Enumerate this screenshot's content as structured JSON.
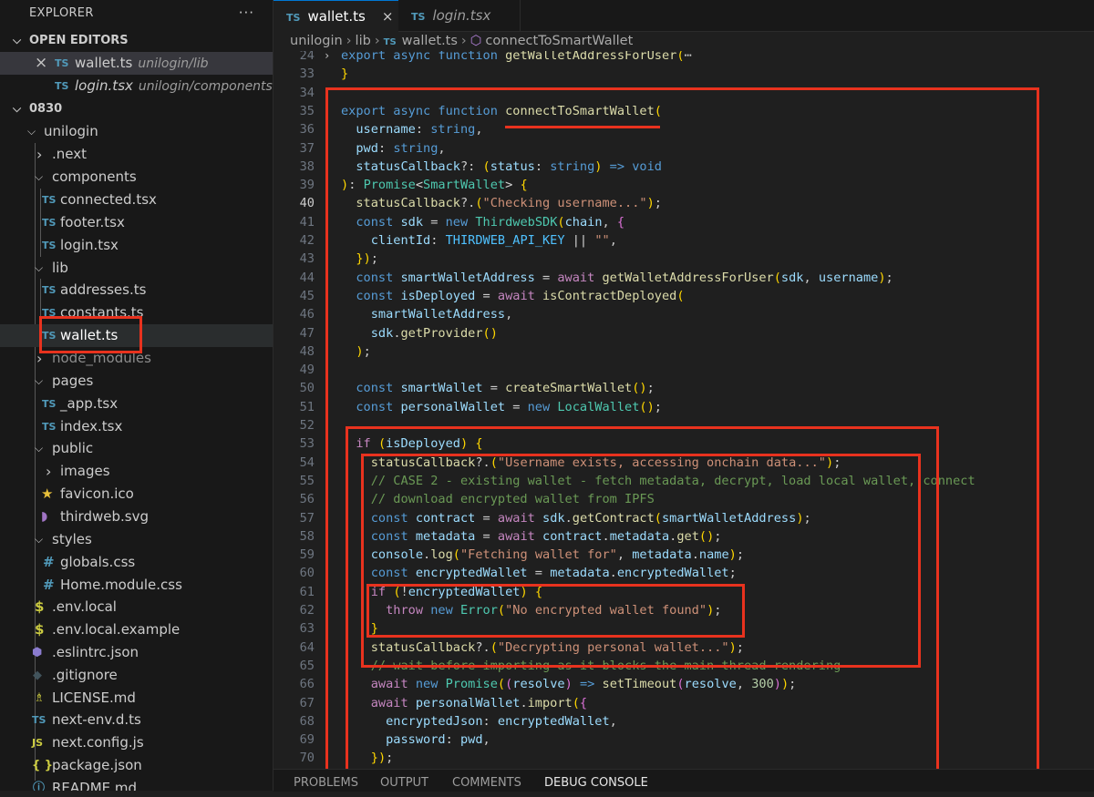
{
  "sidebar": {
    "title": "EXPLORER",
    "more": "···",
    "open_editors_label": "OPEN EDITORS",
    "open_editors": [
      {
        "name": "wallet.ts",
        "path": "unilogin/lib"
      },
      {
        "name": "login.tsx",
        "path": "unilogin/components"
      }
    ],
    "workspace_label": "0830",
    "tree": [
      "unilogin",
      ".next",
      "components",
      "connected.tsx",
      "footer.tsx",
      "login.tsx",
      "lib",
      "addresses.ts",
      "constants.ts",
      "wallet.ts",
      "node_modules",
      "pages",
      "_app.tsx",
      "index.tsx",
      "public",
      "images",
      "favicon.ico",
      "thirdweb.svg",
      "styles",
      "globals.css",
      "Home.module.css",
      ".env.local",
      ".env.local.example",
      ".eslintrc.json",
      ".gitignore",
      "LICENSE.md",
      "next-env.d.ts",
      "next.config.js",
      "package.json",
      "README.md"
    ]
  },
  "icons": {
    "ts": "TS",
    "js": "JS",
    "css": "#",
    "env": "$",
    "json": "{ }",
    "chev_open": "⌵",
    "chev_closed": "›",
    "close": "×"
  },
  "tabs": [
    {
      "label": "wallet.ts",
      "active": true
    },
    {
      "label": "login.tsx",
      "active": false
    }
  ],
  "breadcrumb": [
    "unilogin",
    "lib",
    "wallet.ts",
    "connectToSmartWallet"
  ],
  "editor": {
    "current_line": "40",
    "lines": [
      {
        "n": "24",
        "t": "export async function getWalletAddressForUser(⋯"
      },
      {
        "n": "33",
        "t": "}"
      },
      {
        "n": "34",
        "t": ""
      },
      {
        "n": "35",
        "t": "export async function connectToSmartWallet("
      },
      {
        "n": "36",
        "t": "  username: string,"
      },
      {
        "n": "37",
        "t": "  pwd: string,"
      },
      {
        "n": "38",
        "t": "  statusCallback?: (status: string) => void"
      },
      {
        "n": "39",
        "t": "): Promise<SmartWallet> {"
      },
      {
        "n": "40",
        "t": "  statusCallback?.(\"Checking username...\");"
      },
      {
        "n": "41",
        "t": "  const sdk = new ThirdwebSDK(chain, {"
      },
      {
        "n": "42",
        "t": "    clientId: THIRDWEB_API_KEY || \"\","
      },
      {
        "n": "43",
        "t": "  });"
      },
      {
        "n": "44",
        "t": "  const smartWalletAddress = await getWalletAddressForUser(sdk, username);"
      },
      {
        "n": "45",
        "t": "  const isDeployed = await isContractDeployed("
      },
      {
        "n": "46",
        "t": "    smartWalletAddress,"
      },
      {
        "n": "47",
        "t": "    sdk.getProvider()"
      },
      {
        "n": "48",
        "t": "  );"
      },
      {
        "n": "49",
        "t": ""
      },
      {
        "n": "50",
        "t": "  const smartWallet = createSmartWallet();"
      },
      {
        "n": "51",
        "t": "  const personalWallet = new LocalWallet();"
      },
      {
        "n": "52",
        "t": ""
      },
      {
        "n": "53",
        "t": "  if (isDeployed) {"
      },
      {
        "n": "54",
        "t": "    statusCallback?.(\"Username exists, accessing onchain data...\");"
      },
      {
        "n": "55",
        "t": "    // CASE 2 - existing wallet - fetch metadata, decrypt, load local wallet, connect"
      },
      {
        "n": "56",
        "t": "    // download encrypted wallet from IPFS"
      },
      {
        "n": "57",
        "t": "    const contract = await sdk.getContract(smartWalletAddress);"
      },
      {
        "n": "58",
        "t": "    const metadata = await contract.metadata.get();"
      },
      {
        "n": "59",
        "t": "    console.log(\"Fetching wallet for\", metadata.name);"
      },
      {
        "n": "60",
        "t": "    const encryptedWallet = metadata.encryptedWallet;"
      },
      {
        "n": "61",
        "t": "    if (!encryptedWallet) {"
      },
      {
        "n": "62",
        "t": "      throw new Error(\"No encrypted wallet found\");"
      },
      {
        "n": "63",
        "t": "    }"
      },
      {
        "n": "64",
        "t": "    statusCallback?.(\"Decrypting personal wallet...\");"
      },
      {
        "n": "65",
        "t": "    // wait before importing as it blocks the main thread rendering"
      },
      {
        "n": "66",
        "t": "    await new Promise((resolve) => setTimeout(resolve, 300));"
      },
      {
        "n": "67",
        "t": "    await personalWallet.import({"
      },
      {
        "n": "68",
        "t": "      encryptedJson: encryptedWallet,"
      },
      {
        "n": "69",
        "t": "      password: pwd,"
      },
      {
        "n": "70",
        "t": "    });"
      }
    ]
  },
  "panel": {
    "tabs": [
      "PROBLEMS",
      "OUTPUT",
      "COMMENTS",
      "DEBUG CONSOLE"
    ],
    "active": "DEBUG CONSOLE"
  },
  "colors": {
    "annotation": "#e8321e",
    "accent": "#0078d4",
    "ts_icon": "#519aba",
    "editor_bg": "#1f1f1f",
    "sidebar_bg": "#181818"
  }
}
